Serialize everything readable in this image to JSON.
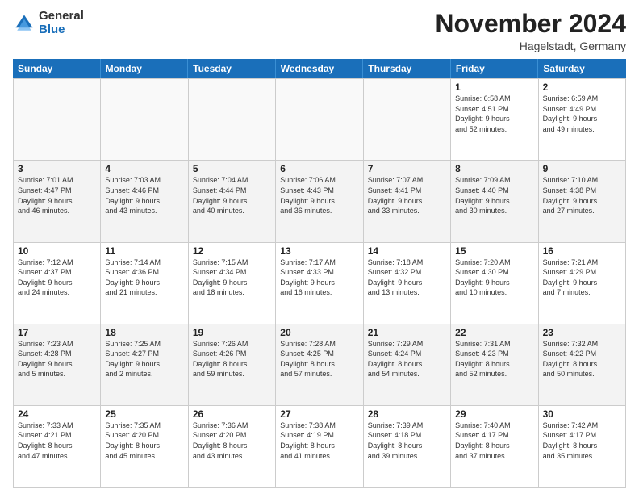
{
  "logo": {
    "general": "General",
    "blue": "Blue"
  },
  "title": "November 2024",
  "location": "Hagelstadt, Germany",
  "header_days": [
    "Sunday",
    "Monday",
    "Tuesday",
    "Wednesday",
    "Thursday",
    "Friday",
    "Saturday"
  ],
  "weeks": [
    [
      {
        "day": "",
        "info": ""
      },
      {
        "day": "",
        "info": ""
      },
      {
        "day": "",
        "info": ""
      },
      {
        "day": "",
        "info": ""
      },
      {
        "day": "",
        "info": ""
      },
      {
        "day": "1",
        "info": "Sunrise: 6:58 AM\nSunset: 4:51 PM\nDaylight: 9 hours\nand 52 minutes."
      },
      {
        "day": "2",
        "info": "Sunrise: 6:59 AM\nSunset: 4:49 PM\nDaylight: 9 hours\nand 49 minutes."
      }
    ],
    [
      {
        "day": "3",
        "info": "Sunrise: 7:01 AM\nSunset: 4:47 PM\nDaylight: 9 hours\nand 46 minutes."
      },
      {
        "day": "4",
        "info": "Sunrise: 7:03 AM\nSunset: 4:46 PM\nDaylight: 9 hours\nand 43 minutes."
      },
      {
        "day": "5",
        "info": "Sunrise: 7:04 AM\nSunset: 4:44 PM\nDaylight: 9 hours\nand 40 minutes."
      },
      {
        "day": "6",
        "info": "Sunrise: 7:06 AM\nSunset: 4:43 PM\nDaylight: 9 hours\nand 36 minutes."
      },
      {
        "day": "7",
        "info": "Sunrise: 7:07 AM\nSunset: 4:41 PM\nDaylight: 9 hours\nand 33 minutes."
      },
      {
        "day": "8",
        "info": "Sunrise: 7:09 AM\nSunset: 4:40 PM\nDaylight: 9 hours\nand 30 minutes."
      },
      {
        "day": "9",
        "info": "Sunrise: 7:10 AM\nSunset: 4:38 PM\nDaylight: 9 hours\nand 27 minutes."
      }
    ],
    [
      {
        "day": "10",
        "info": "Sunrise: 7:12 AM\nSunset: 4:37 PM\nDaylight: 9 hours\nand 24 minutes."
      },
      {
        "day": "11",
        "info": "Sunrise: 7:14 AM\nSunset: 4:36 PM\nDaylight: 9 hours\nand 21 minutes."
      },
      {
        "day": "12",
        "info": "Sunrise: 7:15 AM\nSunset: 4:34 PM\nDaylight: 9 hours\nand 18 minutes."
      },
      {
        "day": "13",
        "info": "Sunrise: 7:17 AM\nSunset: 4:33 PM\nDaylight: 9 hours\nand 16 minutes."
      },
      {
        "day": "14",
        "info": "Sunrise: 7:18 AM\nSunset: 4:32 PM\nDaylight: 9 hours\nand 13 minutes."
      },
      {
        "day": "15",
        "info": "Sunrise: 7:20 AM\nSunset: 4:30 PM\nDaylight: 9 hours\nand 10 minutes."
      },
      {
        "day": "16",
        "info": "Sunrise: 7:21 AM\nSunset: 4:29 PM\nDaylight: 9 hours\nand 7 minutes."
      }
    ],
    [
      {
        "day": "17",
        "info": "Sunrise: 7:23 AM\nSunset: 4:28 PM\nDaylight: 9 hours\nand 5 minutes."
      },
      {
        "day": "18",
        "info": "Sunrise: 7:25 AM\nSunset: 4:27 PM\nDaylight: 9 hours\nand 2 minutes."
      },
      {
        "day": "19",
        "info": "Sunrise: 7:26 AM\nSunset: 4:26 PM\nDaylight: 8 hours\nand 59 minutes."
      },
      {
        "day": "20",
        "info": "Sunrise: 7:28 AM\nSunset: 4:25 PM\nDaylight: 8 hours\nand 57 minutes."
      },
      {
        "day": "21",
        "info": "Sunrise: 7:29 AM\nSunset: 4:24 PM\nDaylight: 8 hours\nand 54 minutes."
      },
      {
        "day": "22",
        "info": "Sunrise: 7:31 AM\nSunset: 4:23 PM\nDaylight: 8 hours\nand 52 minutes."
      },
      {
        "day": "23",
        "info": "Sunrise: 7:32 AM\nSunset: 4:22 PM\nDaylight: 8 hours\nand 50 minutes."
      }
    ],
    [
      {
        "day": "24",
        "info": "Sunrise: 7:33 AM\nSunset: 4:21 PM\nDaylight: 8 hours\nand 47 minutes."
      },
      {
        "day": "25",
        "info": "Sunrise: 7:35 AM\nSunset: 4:20 PM\nDaylight: 8 hours\nand 45 minutes."
      },
      {
        "day": "26",
        "info": "Sunrise: 7:36 AM\nSunset: 4:20 PM\nDaylight: 8 hours\nand 43 minutes."
      },
      {
        "day": "27",
        "info": "Sunrise: 7:38 AM\nSunset: 4:19 PM\nDaylight: 8 hours\nand 41 minutes."
      },
      {
        "day": "28",
        "info": "Sunrise: 7:39 AM\nSunset: 4:18 PM\nDaylight: 8 hours\nand 39 minutes."
      },
      {
        "day": "29",
        "info": "Sunrise: 7:40 AM\nSunset: 4:17 PM\nDaylight: 8 hours\nand 37 minutes."
      },
      {
        "day": "30",
        "info": "Sunrise: 7:42 AM\nSunset: 4:17 PM\nDaylight: 8 hours\nand 35 minutes."
      }
    ]
  ]
}
